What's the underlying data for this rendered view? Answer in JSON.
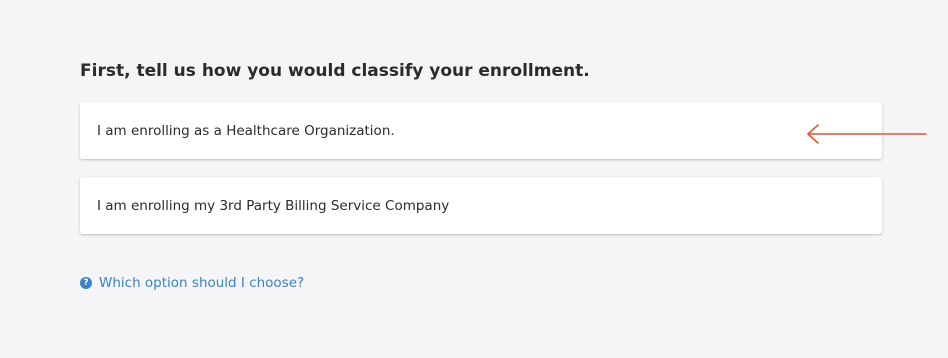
{
  "heading": "First, tell us how you would classify your enrollment.",
  "options": [
    {
      "label": "I am enrolling as a Healthcare Organization."
    },
    {
      "label": "I am enrolling my 3rd Party Billing Service Company"
    }
  ],
  "help": {
    "icon": "question-circle-icon",
    "icon_glyph": "?",
    "label": "Which option should I choose?"
  },
  "annotation": {
    "icon": "left-arrow-icon",
    "color": "#e4572e"
  },
  "colors": {
    "background": "#f5f5f7",
    "card": "#ffffff",
    "link": "#3b82c4",
    "text": "#2b2b2b"
  }
}
